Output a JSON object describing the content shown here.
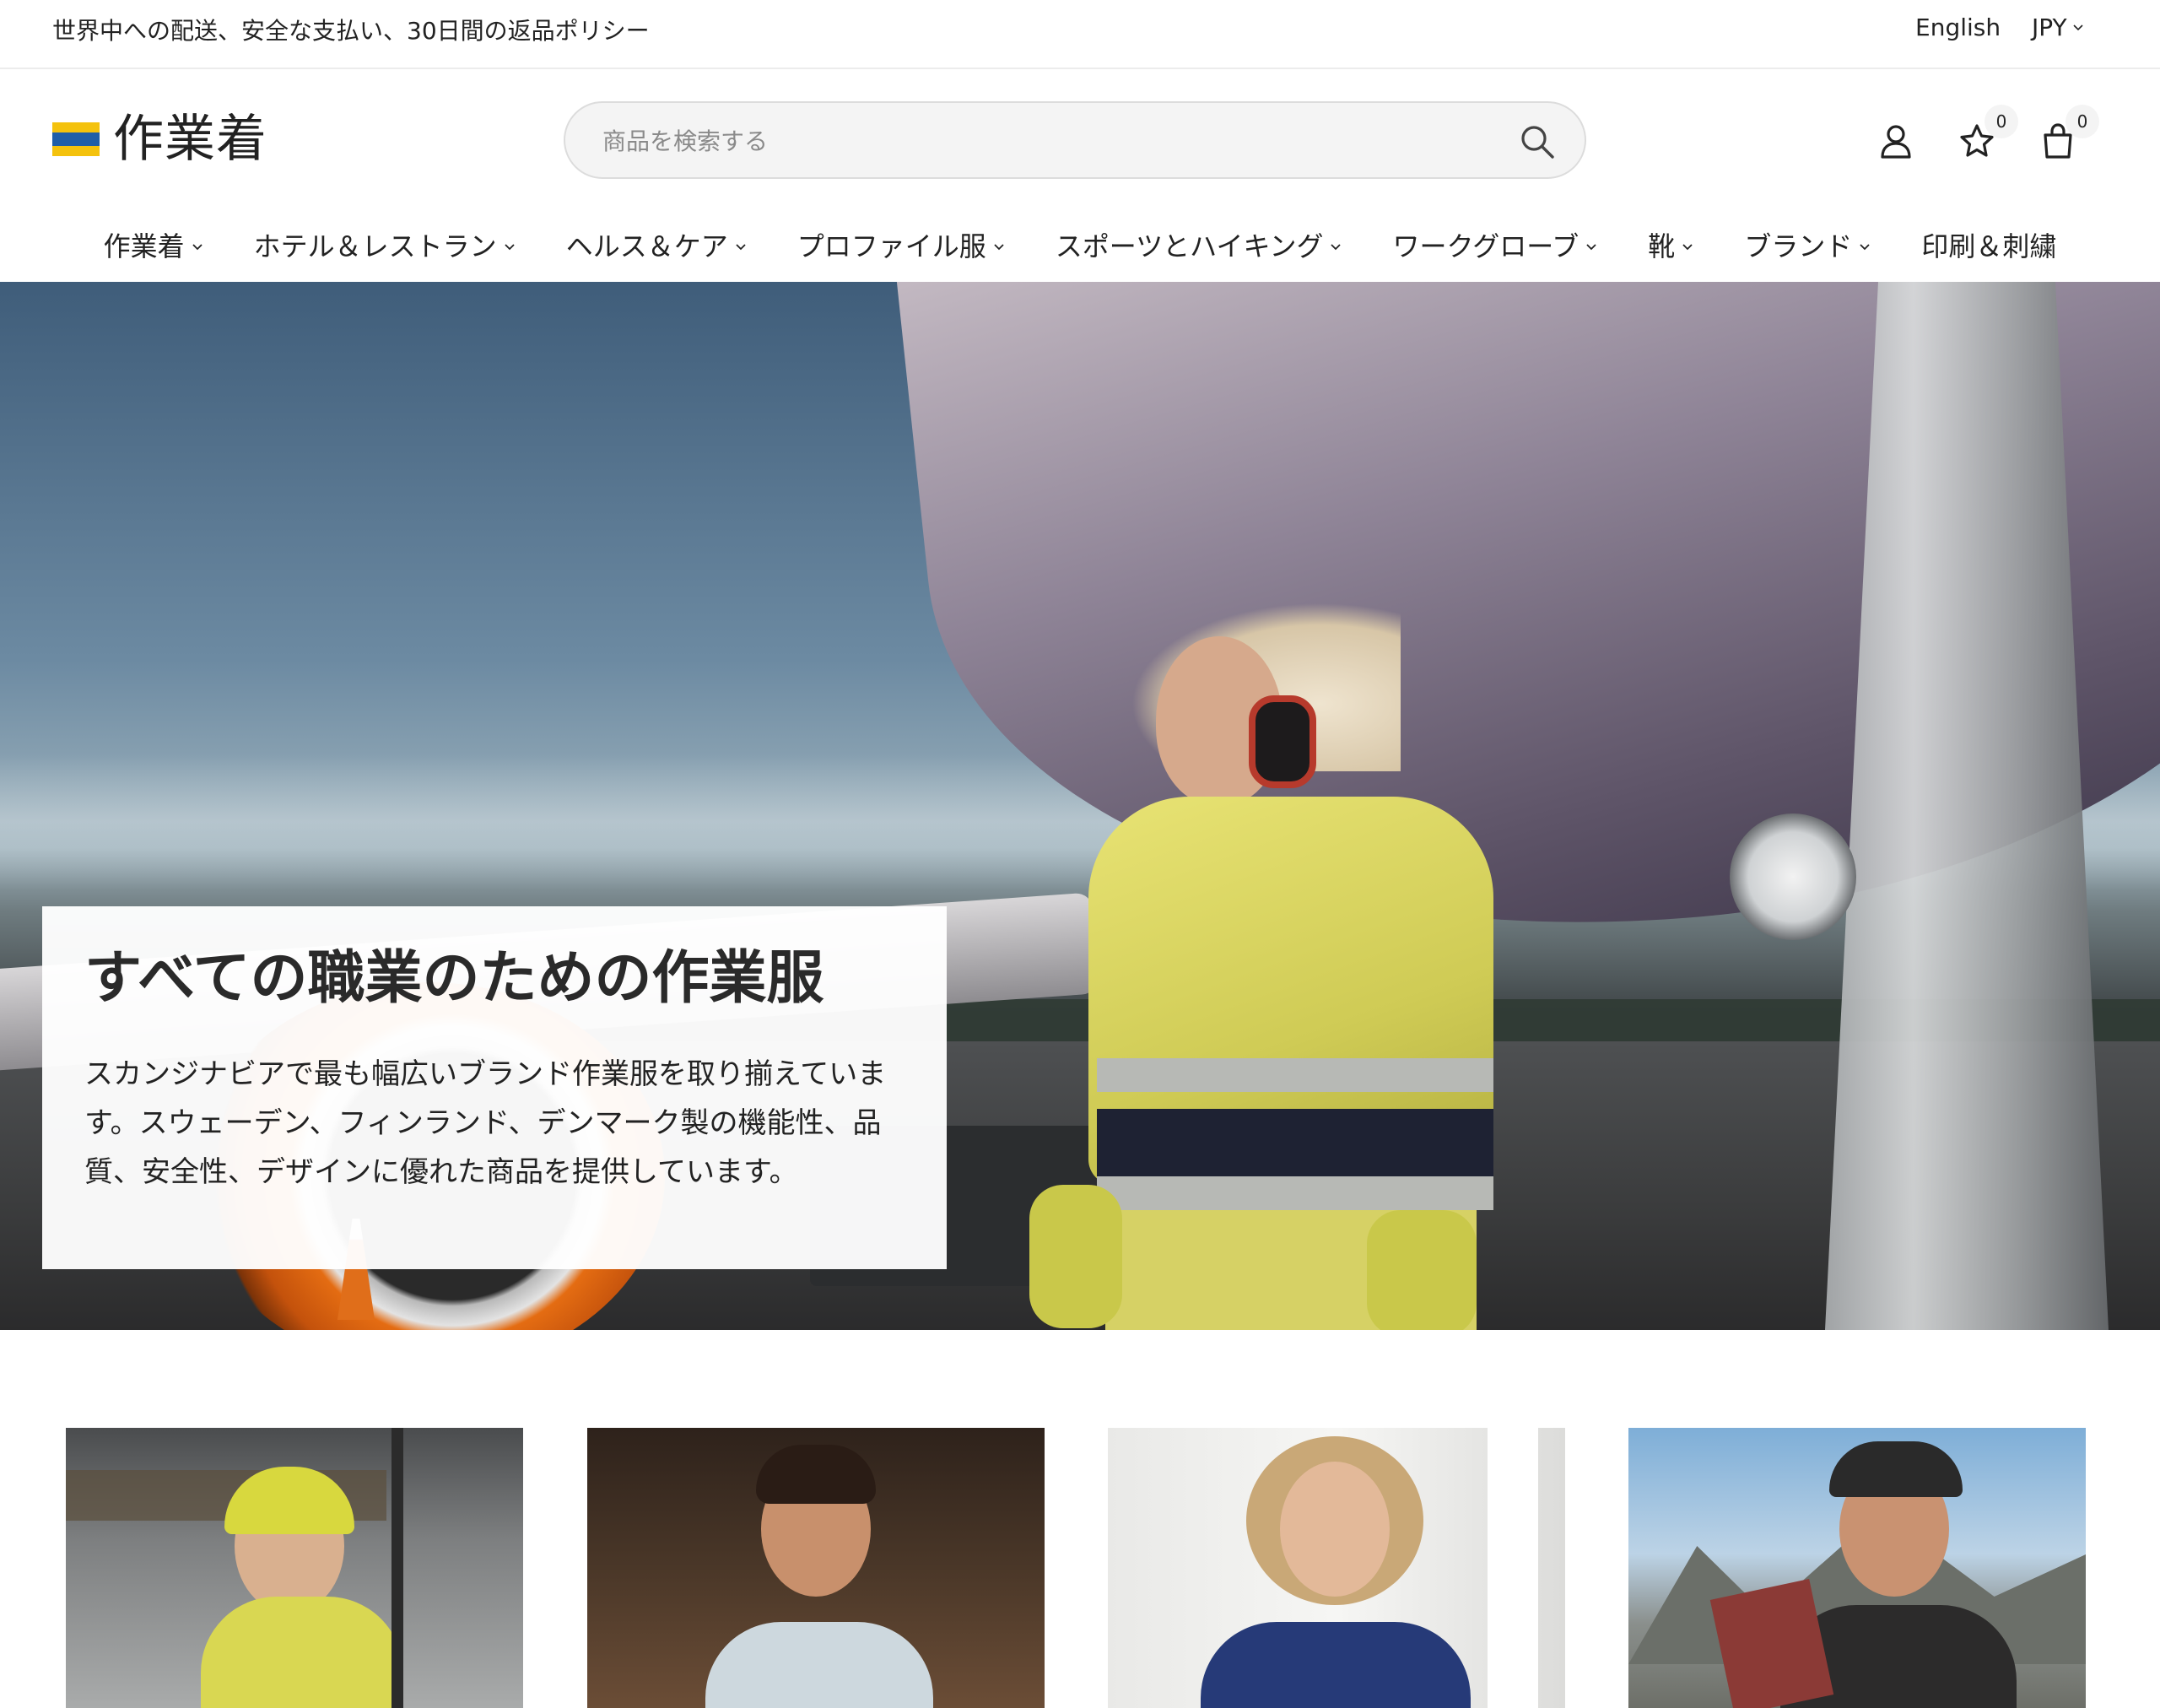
{
  "topbar": {
    "promo": "世界中への配送、安全な支払い、30日間の返品ポリシー",
    "language": "English",
    "currency": "JPY"
  },
  "header": {
    "logo_text": "作業着",
    "search_placeholder": "商品を検索する",
    "wishlist_count": "0",
    "cart_count": "0"
  },
  "nav": {
    "items": [
      {
        "label": "作業着",
        "has_dropdown": true
      },
      {
        "label": "ホテル＆レストラン",
        "has_dropdown": true
      },
      {
        "label": "ヘルス＆ケア",
        "has_dropdown": true
      },
      {
        "label": "プロファイル服",
        "has_dropdown": true
      },
      {
        "label": "スポーツとハイキング",
        "has_dropdown": true
      },
      {
        "label": "ワークグローブ",
        "has_dropdown": true
      },
      {
        "label": "靴",
        "has_dropdown": true
      },
      {
        "label": "ブランド",
        "has_dropdown": true
      },
      {
        "label": "印刷＆刺繍",
        "has_dropdown": false
      }
    ]
  },
  "hero": {
    "title": "すべての職業のための作業服",
    "description": "スカンジナビアで最も幅広いブランド作業服を取り揃えています。スウェーデン、フィンランド、デンマーク製の機能性、品質、安全性、デザインに優れた商品を提供しています。"
  },
  "colors": {
    "logo_yellow": "#f4c20d",
    "logo_blue": "#1f5ea8",
    "search_bg": "#f4f4f4",
    "text": "#222222"
  },
  "icons": [
    "search-icon",
    "account-icon",
    "wishlist-star-icon",
    "cart-bag-icon",
    "chevron-down-icon"
  ]
}
